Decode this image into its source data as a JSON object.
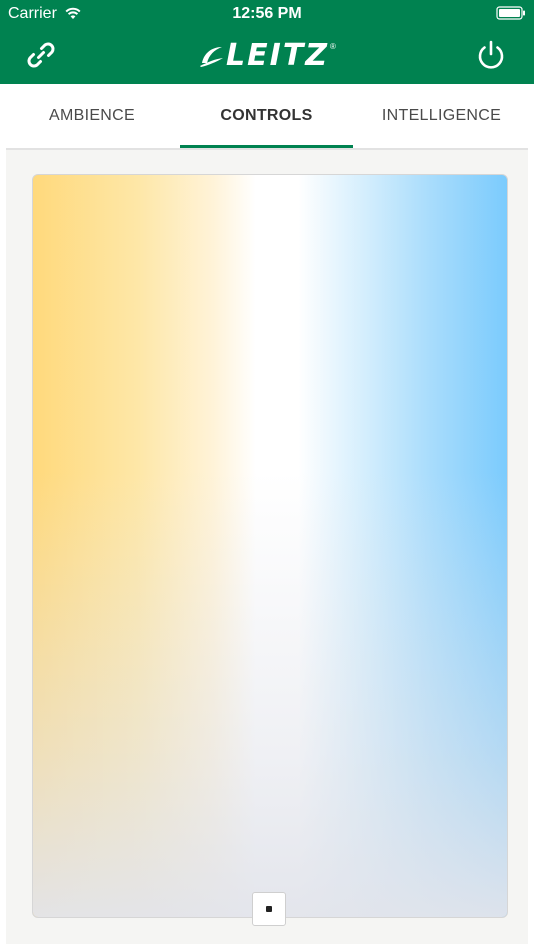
{
  "status_bar": {
    "carrier": "Carrier",
    "time": "12:56 PM",
    "wifi_icon": "wifi-icon",
    "battery_icon": "battery-icon"
  },
  "header": {
    "brand": "LEITZ",
    "registered_mark": "®",
    "link_icon": "link-icon",
    "power_icon": "power-icon",
    "background_color": "#008250"
  },
  "tabs": [
    {
      "label": "AMBIENCE",
      "active": false
    },
    {
      "label": "CONTROLS",
      "active": true
    },
    {
      "label": "INTELLIGENCE",
      "active": false
    }
  ],
  "controls": {
    "color_field": {
      "warm_color": "#ffd97c",
      "neutral_color": "#ffffff",
      "cool_color": "#7bcbfd"
    },
    "handle_position": {
      "temperature_fraction": 0.5,
      "brightness_fraction": 0.0
    }
  }
}
